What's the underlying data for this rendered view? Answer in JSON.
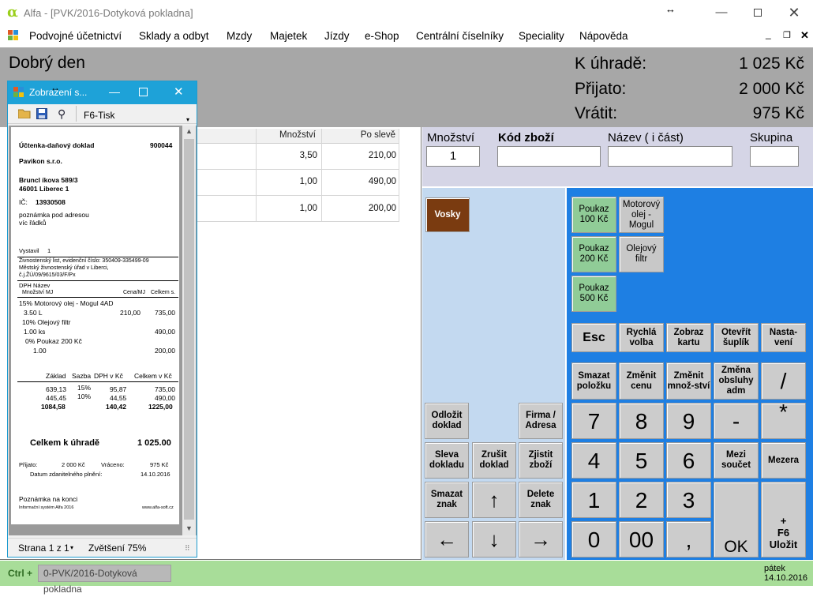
{
  "window": {
    "title": "Alfa - [PVK/2016-Dotyková pokladna]"
  },
  "menu": [
    "Podvojné účetnictví",
    "Sklady a odbyt",
    "Mzdy",
    "Majetek",
    "Jízdy",
    "e-Shop",
    "Centrální číselníky",
    "Speciality",
    "Nápověda"
  ],
  "header": {
    "greeting": "Dobrý den",
    "due_label": "K úhradě:",
    "due_value": "1 025 Kč",
    "received_label": "Přijato:",
    "received_value": "2 000 Kč",
    "change_label": "Vrátit:",
    "change_value": "975 Kč"
  },
  "grid": {
    "headers": [
      "Množství",
      "Po slevě"
    ],
    "rows": [
      {
        "qty": "3,50",
        "price": "210,00"
      },
      {
        "qty": "1,00",
        "price": "490,00"
      },
      {
        "qty": "1,00",
        "price": "200,00"
      }
    ]
  },
  "inputs": {
    "qty_label": "Množství",
    "qty_value": "1",
    "code_label": "Kód zboží",
    "name_label": "Název ( i část)",
    "group_label": "Skupina"
  },
  "keys": {
    "vosky": "Vosky",
    "poukaz100": "Poukaz 100 Kč",
    "motor": "Motorový olej - Mogul",
    "poukaz200": "Poukaz 200 Kč",
    "olej": "Olejový filtr",
    "poukaz500": "Poukaz 500 Kč",
    "esc": "Esc",
    "rychla": "Rychlá volba",
    "zobraz": "Zobraz kartu",
    "otevrit": "Otevřít šuplík",
    "nastaveni": "Nasta-vení",
    "smazat_pol": "Smazat položku",
    "zmenit_cenu": "Změnit cenu",
    "zmenit_mn": "Změnit množ-ství",
    "zmena_obs": "Změna obsluhy adm",
    "slash": "/",
    "star": "*",
    "minus": "-",
    "odlozit": "Odložit doklad",
    "firma": "Firma / Adresa",
    "sleva": "Sleva dokladu",
    "zrusit": "Zrušit doklad",
    "zjistit": "Zjistit zboží",
    "smazat_znak": "Smazat znak",
    "delete_znak": "Delete znak",
    "mezisoucet": "Mezi součet",
    "mezera": "Mezera",
    "n7": "7",
    "n8": "8",
    "n9": "9",
    "n4": "4",
    "n5": "5",
    "n6": "6",
    "n1": "1",
    "n2": "2",
    "n3": "3",
    "n0": "0",
    "n00": "00",
    "comma": ",",
    "ok": "OK",
    "ulozit_plus": "+",
    "ulozit_f6": "F6",
    "ulozit": "Uložit"
  },
  "status": {
    "prefix": "Ctrl +",
    "tab": "0-PVK/2016-Dotyková pokladna",
    "day": "pátek",
    "date": "14.10.2016"
  },
  "popup": {
    "title": "Zobrazení s...",
    "print": "F6-Tisk",
    "page": "Strana 1 z 1",
    "zoom": "Zvětšení 75%",
    "receipt": {
      "doc_title": "Účtenka-daňový doklad",
      "doc_no": "900044",
      "company": "Pavikon s.r.o.",
      "street": "Bruncl íkova 589/3",
      "city": "46001  Liberec 1",
      "ico_label": "IČ:",
      "ico": "13930508",
      "note1": "poznámka pod adresou",
      "note2": "víc řádků",
      "issued": "Vystavil",
      "issued_no": "1",
      "license1": "Živnostenský list, evidenční číslo: 350409-335499-09",
      "license2": "Městský živnostenský úřad v Liberci,",
      "license3": "č.j.ŽÚ/09/9615/03/F/Px",
      "h_dph": "DPH",
      "h_name": "Název",
      "h_qty": "Množství MJ",
      "h_unit": "Cena/MJ",
      "h_total": "Celkem s.",
      "i1_name": "15% Motorový olej - Mogul 4AD",
      "i1_qty": "3.50 L",
      "i1_unit": "210,00",
      "i1_total": "735,00",
      "i2_name": "10% Olejový filtr",
      "i2_qty": "1.00 ks",
      "i2_total": "490,00",
      "i3_name": "0% Poukaz 200 Kč",
      "i3_qty": "1.00",
      "i3_total": "200,00",
      "t_base": "Základ",
      "t_rate": "Sazba",
      "t_vat": "DPH v Kč",
      "t_total": "Celkem v Kč",
      "r1_base": "639,13",
      "r1_rate": "15%",
      "r1_vat": "95,87",
      "r1_total": "735,00",
      "r2_base": "445,45",
      "r2_rate": "10%",
      "r2_vat": "44,55",
      "r2_total": "490,00",
      "r3_base": "1084,58",
      "r3_vat": "140,42",
      "r3_total": "1225,00",
      "sum_label": "Celkem k úhradě",
      "sum_value": "1 025.00",
      "rec_label": "Přijato:",
      "rec_value": "2 000 Kč",
      "ret_label": "Vráceno:",
      "ret_value": "975 Kč",
      "date_label": "Datum zdanitelného plnění:",
      "date_value": "14.10.2016",
      "footer_note": "Poznámka na konci",
      "footer_sys": "Informační systém Alfa 2016",
      "footer_web": "www.alfa-soft.cz"
    }
  }
}
